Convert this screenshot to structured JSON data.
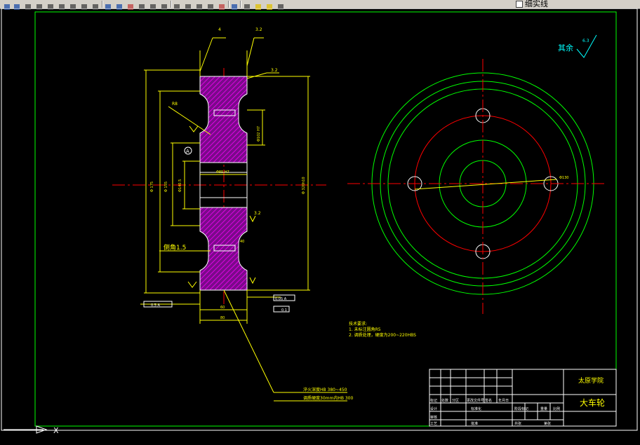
{
  "toolbar": {
    "layer_name": "细实线",
    "colors": {
      "face": "#d4d0c8",
      "shadow": "#808080",
      "accent": "#1f4fa8"
    },
    "buttons": [
      {
        "name": "arrow-icon",
        "color": "#1f4fa8"
      },
      {
        "name": "save-icon",
        "color": "#1f4fa8"
      },
      {
        "name": "print-icon",
        "color": "#404040"
      },
      {
        "name": "plot-preview-icon",
        "color": "#404040"
      },
      {
        "name": "publish-icon",
        "color": "#404040"
      },
      {
        "name": "cut-icon",
        "color": "#404040"
      },
      {
        "name": "copy-icon",
        "color": "#404040"
      },
      {
        "name": "paste-icon",
        "color": "#404040"
      },
      {
        "name": "match-properties-icon",
        "color": "#404040"
      },
      {
        "name": "undo-icon",
        "color": "#1f4fa8"
      },
      {
        "name": "redo-icon",
        "color": "#1f4fa8"
      },
      {
        "name": "pan-icon",
        "color": "#c04040"
      },
      {
        "name": "zoom-realtime-icon",
        "color": "#404040"
      },
      {
        "name": "zoom-window-icon",
        "color": "#404040"
      },
      {
        "name": "zoom-previous-icon",
        "color": "#404040"
      },
      {
        "name": "properties-icon",
        "color": "#404040"
      },
      {
        "name": "design-center-icon",
        "color": "#404040"
      },
      {
        "name": "tool-palette-icon",
        "color": "#404040"
      },
      {
        "name": "markup-icon",
        "color": "#404040"
      },
      {
        "name": "calculator-icon",
        "color": "#c04040"
      },
      {
        "name": "help-icon",
        "color": "#1f4fa8"
      },
      {
        "name": "layer-manager-icon",
        "color": "#404040"
      },
      {
        "name": "layer-bulb-icon",
        "color": "#e0c000"
      },
      {
        "name": "layer-sun-icon",
        "color": "#e0c000"
      },
      {
        "name": "layer-lock-icon",
        "color": "#404040"
      }
    ]
  },
  "drawing": {
    "colors": {
      "background": "#000000",
      "border": "#00ff00",
      "dimension": "#ffff00",
      "centerline": "#ff0000",
      "section_hatch": "#ff00ff",
      "outline": "#ffffff",
      "circle_inner": "#00ff00",
      "circle_red": "#ff0000",
      "title_text": "#ffff00",
      "roughness_symbol": "#00ffff"
    },
    "surface_note": "其余",
    "surface_note_value": "6.3",
    "dims": {
      "top_a": "4",
      "top_b": "3.2",
      "top_c": "3.2",
      "r8": "R8",
      "bore_dim": "Φ85 H7",
      "hub_dim": "Φ102 H7",
      "d1": "Φ 175",
      "d2": "Φ 155",
      "d3": "Φ140.5",
      "d_outer": "Φ 320h10",
      "chamfer": "倒角1.5",
      "r_right": "3.2",
      "tol_box": "0.05 A",
      "tol_box2": "0.1",
      "bottom_left": "0.5 A",
      "hub_width": "60",
      "bottom_width": "80",
      "circle_r": "Φ130",
      "sym_a": "A",
      "kw": "40",
      "note_line1": "淬火深度HB 380~450",
      "note_line2": "调质硬度30mm内HB 300"
    },
    "tech_req": {
      "title": "技术要求:",
      "items": [
        "1. 未标注圆角R5",
        "2. 调质处理，硬度为200~220HBS"
      ]
    },
    "title_block": {
      "school": "太原学院",
      "part_name": "大车轮",
      "row_labels": [
        "标记",
        "处数",
        "分区",
        "更改文件号",
        "签名",
        "年月日"
      ],
      "designer": "设计",
      "standard": "标准化",
      "stage": "阶段标记",
      "weight": "重量",
      "scale": "比例",
      "review": "审核",
      "process": "工艺",
      "approve": "批准",
      "sheets": "共张",
      "sheet_no": "第张"
    },
    "coordinate_icon_label": "X"
  }
}
